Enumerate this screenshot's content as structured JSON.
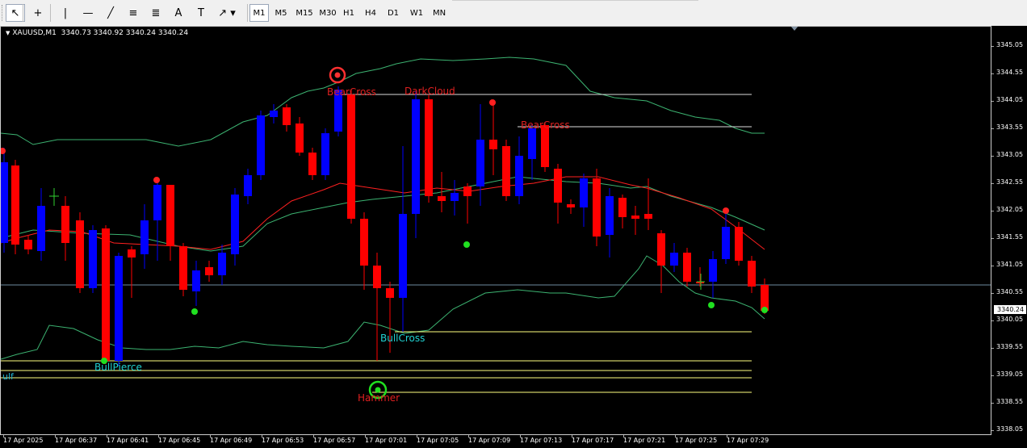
{
  "toolbar": {
    "tools": [
      {
        "name": "cursor-arrow-icon",
        "glyph": "↖"
      },
      {
        "name": "crosshair-icon",
        "glyph": "+"
      },
      {
        "name": "vertical-line-icon",
        "glyph": "|"
      },
      {
        "name": "horizontal-line-icon",
        "glyph": "—"
      },
      {
        "name": "trendline-icon",
        "glyph": "╱"
      },
      {
        "name": "equidistant-channel-icon",
        "glyph": "≡"
      },
      {
        "name": "fibonacci-icon",
        "glyph": "≣"
      },
      {
        "name": "text-icon",
        "glyph": "A"
      },
      {
        "name": "text-label-icon",
        "glyph": "T"
      },
      {
        "name": "arrows-dropdown-icon",
        "glyph": "↗"
      }
    ],
    "timeframes": [
      "M1",
      "M5",
      "M15",
      "M30",
      "H1",
      "H4",
      "D1",
      "W1",
      "MN"
    ],
    "active_timeframe": "M1"
  },
  "chart": {
    "symbol_header": "XAUUSD,M1  3340.73 3340.92 3340.24 3340.24",
    "current_price_label": "3340.24",
    "side_label": "ulf",
    "price_labels": [
      "3345.05",
      "3344.55",
      "3344.05",
      "3343.55",
      "3343.05",
      "3342.55",
      "3342.05",
      "3341.55",
      "3341.05",
      "3340.55",
      "3340.05",
      "3339.55",
      "3339.05",
      "3338.55",
      "3338.05"
    ],
    "time_labels": [
      "17 Apr 2025",
      "17 Apr 06:37",
      "17 Apr 06:41",
      "17 Apr 06:45",
      "17 Apr 06:49",
      "17 Apr 06:53",
      "17 Apr 06:57",
      "17 Apr 07:01",
      "17 Apr 07:05",
      "17 Apr 07:09",
      "17 Apr 07:13",
      "17 Apr 07:17",
      "17 Apr 07:21",
      "17 Apr 07:25",
      "17 Apr 07:29"
    ],
    "annotations": [
      {
        "text": "BearCross",
        "color": "#e02020"
      },
      {
        "text": "DarkCloud",
        "color": "#e02020"
      },
      {
        "text": "BearCross",
        "color": "#e02020"
      },
      {
        "text": "BullCross",
        "color": "#20d0d0"
      },
      {
        "text": "BullPierce",
        "color": "#20d0d0"
      },
      {
        "text": "Hammer",
        "color": "#e02020"
      }
    ],
    "colors": {
      "bull": "#0000ff",
      "bear": "#ff0000",
      "band": "#3cb371",
      "ma": "#ff2020",
      "level_white": "#dddddd",
      "level_yellow": "#ffff80"
    }
  }
}
